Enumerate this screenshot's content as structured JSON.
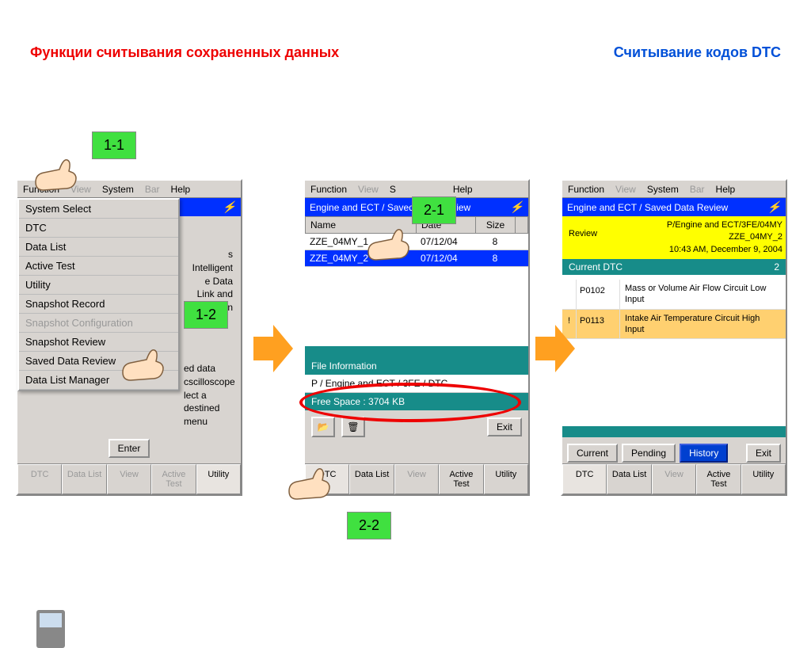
{
  "titles": {
    "left": "Функции считывания сохраненных данных",
    "right": "Считывание кодов DTC"
  },
  "steps": {
    "s11": "1-1",
    "s12": "1-2",
    "s21": "2-1",
    "s22": "2-2"
  },
  "menubar": {
    "function": "Function",
    "view": "View",
    "system": "System",
    "bar": "Bar",
    "help": "Help"
  },
  "titlebars": {
    "p2": "Engine and ECT / Saved Data Review",
    "p3": "Engine and ECT / Saved Data Review"
  },
  "dropdown": {
    "items": [
      "System Select",
      "DTC",
      "Data List",
      "Active Test",
      "Utility",
      "Snapshot Record",
      "Snapshot Configuration",
      "Snapshot Review",
      "Saved Data Review",
      "Data List Manager"
    ]
  },
  "bgtext1": "s Intelligent e Data Link and turn the n",
  "bgtext2": "ed data cscilloscope lect a destined menu",
  "enter": "Enter",
  "exit": "Exit",
  "table": {
    "headers": {
      "name": "Name",
      "date": "Date",
      "size": "Size"
    },
    "rows": [
      {
        "name": "ZZE_04MY_1",
        "date": "07/12/04",
        "size": "8"
      },
      {
        "name": "ZZE_04MY_2",
        "date": "07/12/04",
        "size": "8"
      }
    ]
  },
  "fileinfo": {
    "label": "File Information",
    "path": "P / Engine and ECT / 3FE / DTC",
    "free": "Free Space : 3704 KB"
  },
  "tabs": {
    "dtc": "DTC",
    "datalist": "Data List",
    "view": "View",
    "activetest": "Active Test",
    "utility": "Utility"
  },
  "review": {
    "label": "Review",
    "line1": "P/Engine and ECT/3FE/04MY",
    "line2": "ZZE_04MY_2",
    "line3": "10:43 AM, December 9, 2004"
  },
  "dtc": {
    "header": "Current DTC",
    "count": "2",
    "rows": [
      {
        "mark": "",
        "code": "P0102",
        "desc": "Mass or Volume Air Flow Circuit Low Input"
      },
      {
        "mark": "!",
        "code": "P0113",
        "desc": "Intake Air Temperature Circuit High Input"
      }
    ]
  },
  "filter": {
    "current": "Current",
    "pending": "Pending",
    "history": "History"
  }
}
